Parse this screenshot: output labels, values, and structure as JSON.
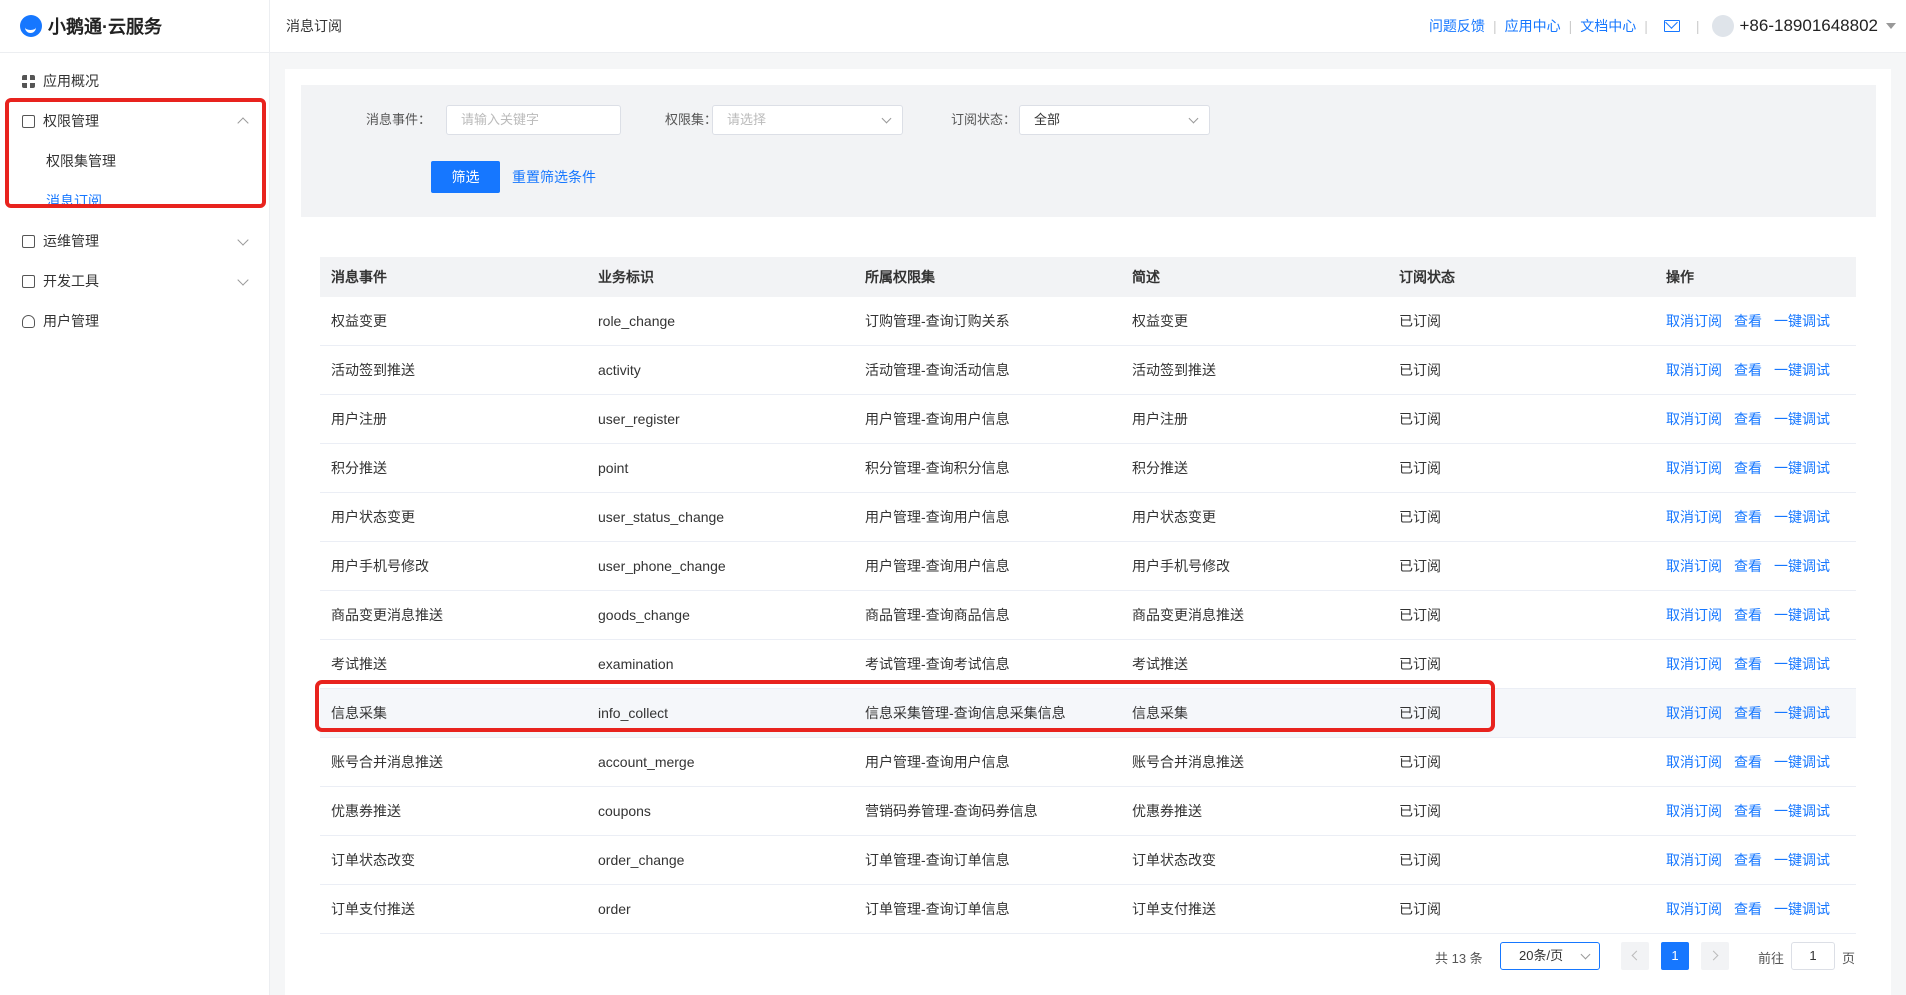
{
  "app": {
    "title": "小鹅通·云服务"
  },
  "sidebar": {
    "items": [
      {
        "label": "应用概况"
      },
      {
        "label": "权限管理"
      },
      {
        "label": "运维管理"
      },
      {
        "label": "开发工具"
      },
      {
        "label": "用户管理"
      }
    ],
    "sub_items": [
      {
        "label": "权限集管理"
      },
      {
        "label": "消息订阅"
      }
    ]
  },
  "header": {
    "breadcrumb": "消息订阅",
    "links": [
      "问题反馈",
      "应用中心",
      "文档中心"
    ],
    "separator": "|",
    "phone": "+86-18901648802"
  },
  "filter": {
    "event_label": "消息事件：",
    "event_placeholder": "请输入关键字",
    "scope_label": "权限集：",
    "scope_placeholder": "请选择",
    "status_label": "订阅状态：",
    "status_value": "全部",
    "filter_button": "筛选",
    "reset_link": "重置筛选条件"
  },
  "table": {
    "headers": [
      "消息事件",
      "业务标识",
      "所属权限集",
      "简述",
      "订阅状态",
      "操作"
    ],
    "actions": [
      "取消订阅",
      "查看",
      "一键调试"
    ],
    "rows": [
      [
        "权益变更",
        "role_change",
        "订购管理-查询订购关系",
        "权益变更",
        "已订阅"
      ],
      [
        "活动签到推送",
        "activity",
        "活动管理-查询活动信息",
        "活动签到推送",
        "已订阅"
      ],
      [
        "用户注册",
        "user_register",
        "用户管理-查询用户信息",
        "用户注册",
        "已订阅"
      ],
      [
        "积分推送",
        "point",
        "积分管理-查询积分信息",
        "积分推送",
        "已订阅"
      ],
      [
        "用户状态变更",
        "user_status_change",
        "用户管理-查询用户信息",
        "用户状态变更",
        "已订阅"
      ],
      [
        "用户手机号修改",
        "user_phone_change",
        "用户管理-查询用户信息",
        "用户手机号修改",
        "已订阅"
      ],
      [
        "商品变更消息推送",
        "goods_change",
        "商品管理-查询商品信息",
        "商品变更消息推送",
        "已订阅"
      ],
      [
        "考试推送",
        "examination",
        "考试管理-查询考试信息",
        "考试推送",
        "已订阅"
      ],
      [
        "信息采集",
        "info_collect",
        "信息采集管理-查询信息采集信息",
        "信息采集",
        "已订阅"
      ],
      [
        "账号合并消息推送",
        "account_merge",
        "用户管理-查询用户信息",
        "账号合并消息推送",
        "已订阅"
      ],
      [
        "优惠券推送",
        "coupons",
        "营销码券管理-查询码券信息",
        "优惠券推送",
        "已订阅"
      ],
      [
        "订单状态改变",
        "order_change",
        "订单管理-查询订单信息",
        "订单状态改变",
        "已订阅"
      ],
      [
        "订单支付推送",
        "order",
        "订单管理-查询订单信息",
        "订单支付推送",
        "已订阅"
      ]
    ]
  },
  "pagination": {
    "total": "共 13 条",
    "page_size": "20条/页",
    "current_page": "1",
    "goto_label": "前往",
    "goto_value": "1",
    "page_suffix": "页"
  },
  "colors": {
    "accent": "#1677ff",
    "highlight": "#e8231e"
  }
}
